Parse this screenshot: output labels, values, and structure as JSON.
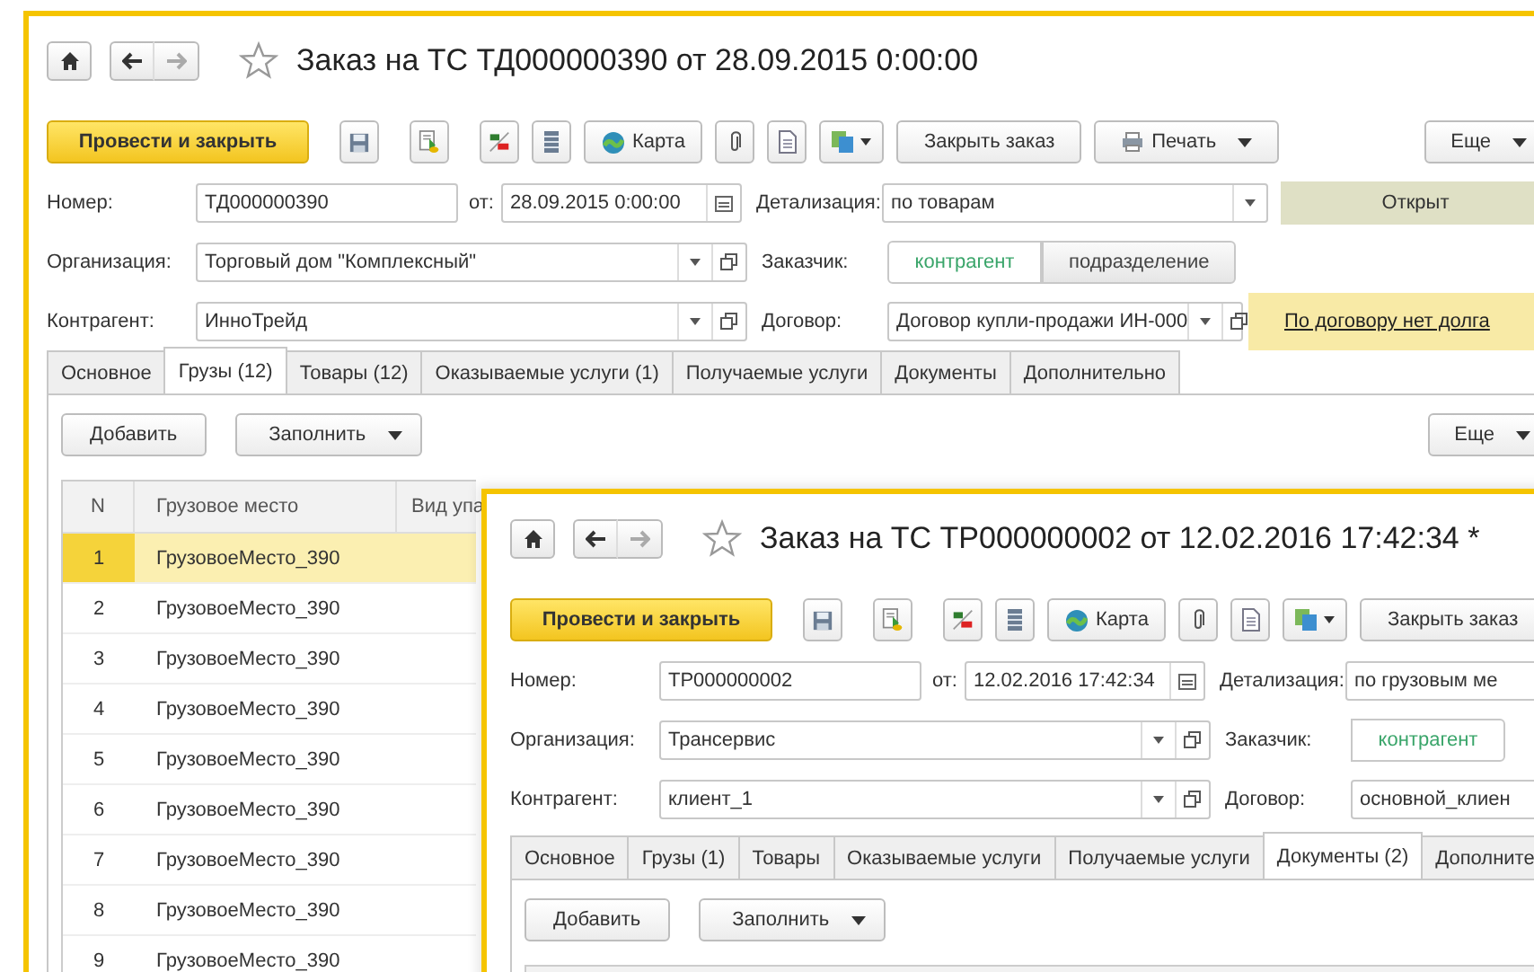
{
  "windows": [
    {
      "title": "Заказ на ТС ТД000000390 от 28.09.2015 0:00:00",
      "toolbar": [
        {
          "kind": "primary",
          "label": "Провести и закрыть"
        },
        {
          "kind": "save"
        },
        {
          "kind": "post"
        },
        {
          "kind": "dtkt"
        },
        {
          "kind": "list"
        },
        {
          "kind": "map",
          "label": "Карта"
        },
        {
          "kind": "clip"
        },
        {
          "kind": "doc"
        },
        {
          "kind": "related"
        },
        {
          "kind": "button",
          "label": "Закрыть заказ"
        },
        {
          "kind": "print",
          "label": "Печать"
        },
        {
          "kind": "more",
          "label": "Еще"
        }
      ],
      "number": {
        "label": "Номер:",
        "value": "ТД000000390"
      },
      "date": {
        "label": "от:",
        "value": "28.09.2015  0:00:00"
      },
      "detail": {
        "label": "Детализация:",
        "value": "по товарам"
      },
      "status": "Открыт",
      "organization": {
        "label": "Организация:",
        "value": "Торговый дом \"Комплексный\""
      },
      "customer": {
        "label": "Заказчик:",
        "options": [
          {
            "label": "контрагент",
            "selected": true
          },
          {
            "label": "подразделение",
            "selected": false
          }
        ]
      },
      "counterparty": {
        "label": "Контрагент:",
        "value": "ИнноТрейд"
      },
      "contract": {
        "label": "Договор:",
        "value": "Договор купли-продажи ИН-000"
      },
      "debt_note": "По договору нет долга",
      "tabs": [
        {
          "label": "Основное",
          "selected": false
        },
        {
          "label": "Грузы (12)",
          "selected": true
        },
        {
          "label": "Товары (12)",
          "selected": false
        },
        {
          "label": "Оказываемые услуги (1)",
          "selected": false
        },
        {
          "label": "Получаемые услуги",
          "selected": false
        },
        {
          "label": "Документы",
          "selected": false
        },
        {
          "label": "Дополнительно",
          "selected": false
        }
      ],
      "panel_buttons": {
        "add": "Добавить",
        "fill": "Заполнить",
        "more": "Еще"
      },
      "table": {
        "columns": [
          "N",
          "Грузовое место",
          "Вид упа"
        ],
        "rows": [
          {
            "n": "1",
            "place": "ГрузовоеМесто_390",
            "selected": true
          },
          {
            "n": "2",
            "place": "ГрузовоеМесто_390",
            "selected": false
          },
          {
            "n": "3",
            "place": "ГрузовоеМесто_390",
            "selected": false
          },
          {
            "n": "4",
            "place": "ГрузовоеМесто_390",
            "selected": false
          },
          {
            "n": "5",
            "place": "ГрузовоеМесто_390",
            "selected": false
          },
          {
            "n": "6",
            "place": "ГрузовоеМесто_390",
            "selected": false
          },
          {
            "n": "7",
            "place": "ГрузовоеМесто_390",
            "selected": false
          },
          {
            "n": "8",
            "place": "ГрузовоеМесто_390",
            "selected": false
          },
          {
            "n": "9",
            "place": "ГрузовоеМесто_390",
            "selected": false
          }
        ]
      }
    },
    {
      "title": "Заказ на ТС ТР000000002 от 12.02.2016 17:42:34 *",
      "toolbar": [
        {
          "kind": "primary",
          "label": "Провести и закрыть"
        },
        {
          "kind": "save"
        },
        {
          "kind": "post"
        },
        {
          "kind": "dtkt"
        },
        {
          "kind": "list"
        },
        {
          "kind": "map",
          "label": "Карта"
        },
        {
          "kind": "clip"
        },
        {
          "kind": "doc"
        },
        {
          "kind": "related"
        },
        {
          "kind": "button",
          "label": "Закрыть заказ"
        }
      ],
      "number": {
        "label": "Номер:",
        "value": "ТР000000002"
      },
      "date": {
        "label": "от:",
        "value": "12.02.2016 17:42:34"
      },
      "detail": {
        "label": "Детализация:",
        "value": "по грузовым ме"
      },
      "organization": {
        "label": "Организация:",
        "value": "Трансервис"
      },
      "customer": {
        "label": "Заказчик:",
        "options": [
          {
            "label": "контрагент",
            "selected": true
          }
        ]
      },
      "counterparty": {
        "label": "Контрагент:",
        "value": "клиент_1"
      },
      "contract": {
        "label": "Договор:",
        "value": "основной_клиен"
      },
      "tabs": [
        {
          "label": "Основное",
          "selected": false
        },
        {
          "label": "Грузы (1)",
          "selected": false
        },
        {
          "label": "Товары",
          "selected": false
        },
        {
          "label": "Оказываемые услуги",
          "selected": false
        },
        {
          "label": "Получаемые услуги",
          "selected": false
        },
        {
          "label": "Документы (2)",
          "selected": true
        },
        {
          "label": "Дополните",
          "selected": false
        }
      ],
      "panel_buttons": {
        "add": "Добавить",
        "fill": "Заполнить"
      }
    }
  ]
}
